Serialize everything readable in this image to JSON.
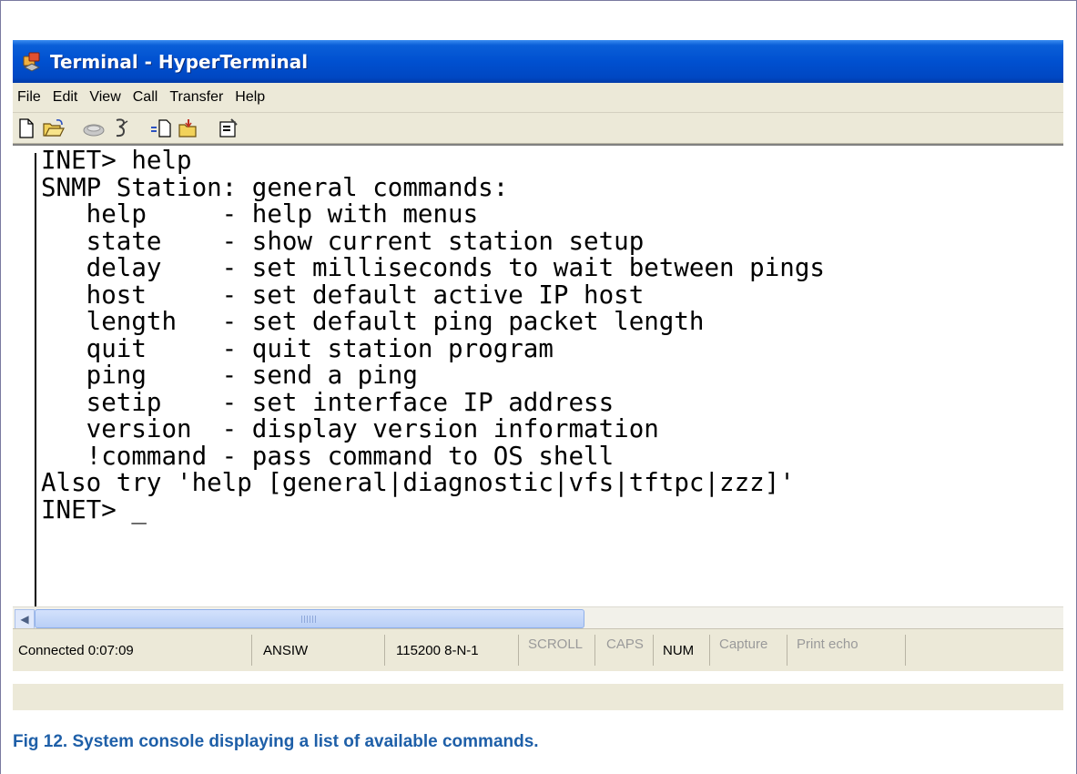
{
  "window": {
    "title": "Terminal - HyperTerminal"
  },
  "menu": [
    "File",
    "Edit",
    "View",
    "Call",
    "Transfer",
    "Help"
  ],
  "toolbar": {
    "icons": [
      "new-file-icon",
      "open-folder-icon",
      "dial-icon",
      "disconnect-icon",
      "send-icon",
      "receive-icon",
      "properties-icon"
    ]
  },
  "terminal": {
    "lines": [
      "INET> help",
      "SNMP Station: general commands:",
      "   help     - help with menus",
      "   state    - show current station setup",
      "   delay    - set milliseconds to wait between pings",
      "   host     - set default active IP host",
      "   length   - set default ping packet length",
      "   quit     - quit station program",
      "   ping     - send a ping",
      "   setip    - set interface IP address",
      "   version  - display version information",
      "   !command - pass command to OS shell",
      "Also try 'help [general|diagnostic|vfs|tftpc|zzz]'",
      "INET> _"
    ]
  },
  "statusbar": {
    "connected": "Connected 0:07:09",
    "emulation": "ANSIW",
    "port_settings": "115200 8-N-1",
    "scroll": "SCROLL",
    "caps": "CAPS",
    "num": "NUM",
    "capture": "Capture",
    "print_echo": "Print echo"
  },
  "caption": "Fig 12. System console displaying a list of available commands."
}
